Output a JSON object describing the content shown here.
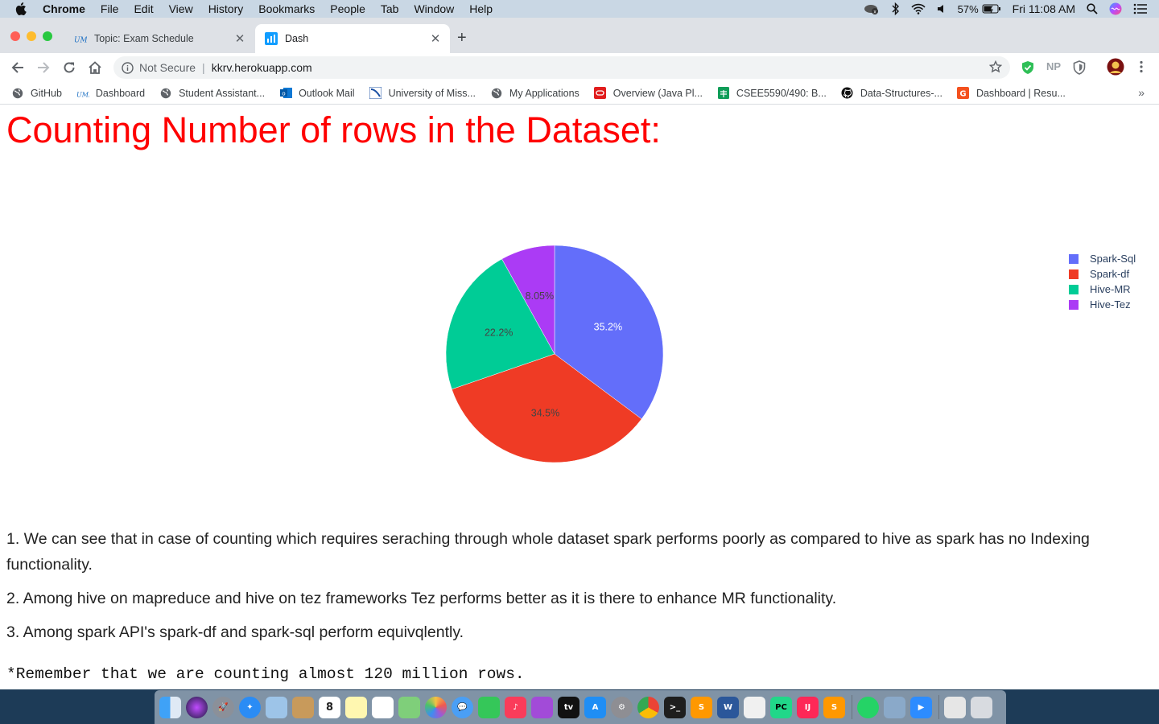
{
  "menubar": {
    "app": "Chrome",
    "items": [
      "File",
      "Edit",
      "View",
      "History",
      "Bookmarks",
      "People",
      "Tab",
      "Window",
      "Help"
    ],
    "battery": "57%",
    "clock": "Fri 11:08 AM"
  },
  "tabs": [
    {
      "label": "Topic: Exam Schedule",
      "active": false
    },
    {
      "label": "Dash",
      "active": true
    }
  ],
  "omnibox": {
    "security": "Not Secure",
    "url": "kkrv.herokuapp.com"
  },
  "extensions": {
    "np": "NP"
  },
  "bookmarks": [
    {
      "label": "GitHub",
      "icon": "globe-icon"
    },
    {
      "label": "Dashboard",
      "icon": "umkc-icon"
    },
    {
      "label": "Student Assistant...",
      "icon": "globe-icon"
    },
    {
      "label": "Outlook Mail",
      "icon": "outlook-icon"
    },
    {
      "label": "University of Miss...",
      "icon": "university-icon"
    },
    {
      "label": "My Applications",
      "icon": "globe-icon"
    },
    {
      "label": "Overview (Java Pl...",
      "icon": "oracle-icon"
    },
    {
      "label": "CSEE5590/490: B...",
      "icon": "sheets-icon"
    },
    {
      "label": "Data-Structures-...",
      "icon": "github-icon"
    },
    {
      "label": "Dashboard | Resu...",
      "icon": "resume-icon"
    }
  ],
  "page": {
    "title": "Counting Number of rows in the Dataset:",
    "notes": [
      "1. We can see that in case of counting which requires seraching through whole dataset spark performs poorly as compared to hive as spark has no Indexing functionality.",
      "2. Among hive on mapreduce and hive on tez frameworks Tez performs better as it is there to enhance MR functionality.",
      "3. Among spark API's spark-df and spark-sql perform equivqlently."
    ],
    "remember": "*Remember that we are counting almost 120 million rows."
  },
  "chart_data": {
    "type": "pie",
    "labels": [
      "Spark-Sql",
      "Spark-df",
      "Hive-MR",
      "Hive-Tez"
    ],
    "values": [
      35.2,
      34.5,
      22.2,
      8.05
    ],
    "percent_labels": [
      "35.2%",
      "34.5%",
      "22.2%",
      "8.05%"
    ],
    "colors": [
      "#636efa",
      "#ef3b25",
      "#00cc96",
      "#ab3bf5"
    ],
    "legend_placement": "top-right"
  }
}
